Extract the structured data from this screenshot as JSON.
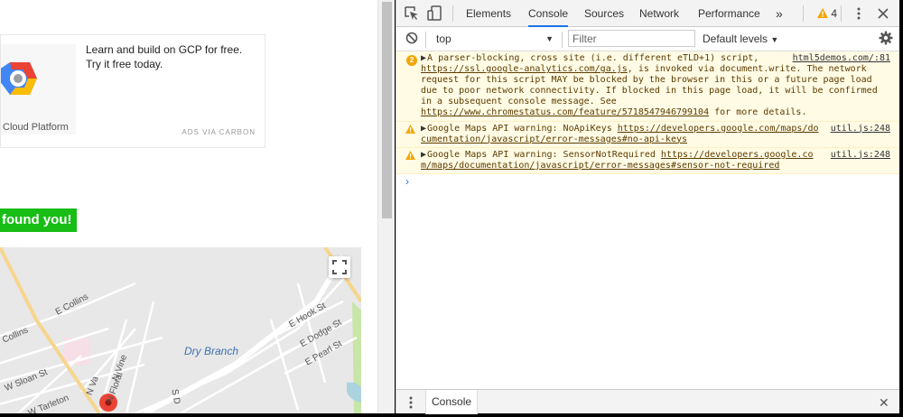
{
  "ad": {
    "text": "Learn and build on GCP for free. Try it free today.",
    "logo_text": "Cloud Platform",
    "via": "ADS VIA CARBON"
  },
  "found_text": "found you!",
  "map": {
    "labels": [
      "E Collins",
      "Collins",
      "W Sloan St",
      "W Tarleton",
      "N Floral",
      "N Vine",
      "N Va",
      "E Hook St",
      "E Dodge St",
      "E Pearl St",
      "S D"
    ],
    "park": "Dry Branch"
  },
  "devtools": {
    "tabs": [
      {
        "label": "Elements",
        "active": false
      },
      {
        "label": "Console",
        "active": true
      },
      {
        "label": "Sources",
        "active": false
      },
      {
        "label": "Network",
        "active": false
      },
      {
        "label": "Performance",
        "active": false
      }
    ],
    "more": "»",
    "warning_count": "4",
    "context": "top",
    "filter_placeholder": "Filter",
    "levels": "Default levels",
    "messages": [
      {
        "badge": "2",
        "text": "A parser-blocking, cross site (i.e. different eTLD+1) script, ",
        "link1": "https://ssl.google-analytics.com/ga.js",
        "text2": ", is invoked via document.write. The network request for this script MAY be blocked by the browser in this or a future page load due to poor network connectivity. If blocked in this page load, it will be confirmed in a subsequent console message. See ",
        "link2": "https://www.chromestatus.com/feature/5718547946799104",
        "text3": " for more details.",
        "source": "html5demos.com/:81"
      },
      {
        "text": "Google Maps API warning: NoApiKeys ",
        "link1": "https://developers.google.com/maps/documentation/javascript/error-messages#no-api-keys",
        "source": "util.js:248"
      },
      {
        "text": "Google Maps API warning: SensorNotRequired ",
        "link1": "https://developers.google.com/maps/documentation/javascript/error-messages#sensor-not-required",
        "source": "util.js:248"
      }
    ],
    "prompt": "›",
    "drawer_tab": "Console",
    "close": "✕"
  },
  "colors": {
    "accent": "#1a73e8",
    "warning_bg": "#fffbe5",
    "warning_icon": "#f2a600",
    "found_bg": "#18bd15",
    "map_pin": "#ea4335"
  },
  "icons": [
    "inspect-icon",
    "device-icon",
    "more-tabs-icon",
    "warning-icon",
    "kebab-icon",
    "close-icon",
    "clear-console-icon",
    "settings-gear-icon",
    "expand-triangle-icon",
    "fullscreen-icon",
    "map-pin-icon",
    "gcp-logo-icon"
  ]
}
